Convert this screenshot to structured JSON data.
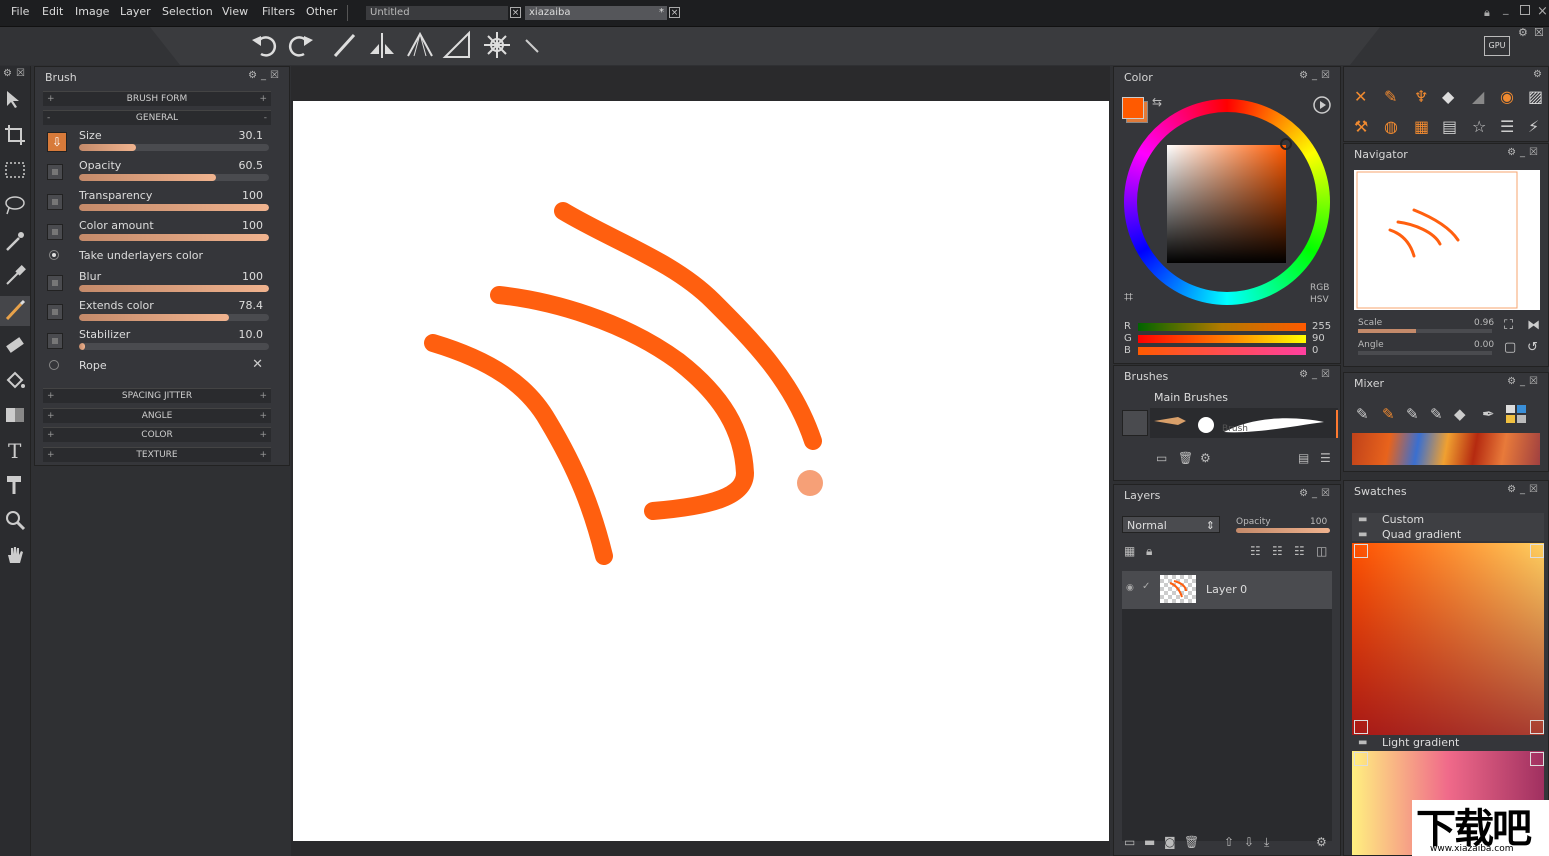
{
  "menu": [
    "File",
    "Edit",
    "Image",
    "Layer",
    "Selection",
    "View",
    "Filters",
    "Other"
  ],
  "tabs": [
    {
      "label": "Untitled"
    },
    {
      "label": "xiazaiba",
      "modified": "*"
    }
  ],
  "window_controls": {
    "close": "×"
  },
  "brush_panel": {
    "title": "Brush",
    "sections": {
      "brush_form": "BRUSH FORM",
      "general": "GENERAL",
      "spacing_jitter": "SPACING JITTER",
      "angle": "ANGLE",
      "color": "COLOR",
      "texture": "TEXTURE"
    },
    "properties": [
      {
        "label": "Size",
        "value": "30.1",
        "fill": 0.3
      },
      {
        "label": "Opacity",
        "value": "60.5",
        "fill": 0.72
      },
      {
        "label": "Transparency",
        "value": "100",
        "fill": 1.0
      },
      {
        "label": "Color amount",
        "value": "100",
        "fill": 1.0
      },
      {
        "label": "Blur",
        "value": "100",
        "fill": 1.0
      },
      {
        "label": "Extends color",
        "value": "78.4",
        "fill": 0.79
      },
      {
        "label": "Stabilizer",
        "value": "10.0",
        "fill": 0.02
      }
    ],
    "take_underlayers": "Take underlayers color",
    "rope": "Rope"
  },
  "color_panel": {
    "title": "Color",
    "mode_rgb": "RGB",
    "mode_hsv": "HSV",
    "r_label": "R",
    "g_label": "G",
    "b_label": "B",
    "r_value": "255",
    "g_value": "90",
    "b_value": "0",
    "current_color": "#ff5a00"
  },
  "brushes_panel": {
    "title": "Brushes",
    "group": "Main Brushes",
    "brush_name": "Brush"
  },
  "layers_panel": {
    "title": "Layers",
    "blend_mode": "Normal",
    "opacity_label": "Opacity",
    "opacity_value": "100",
    "layer_name": "Layer 0"
  },
  "navigator_panel": {
    "title": "Navigator",
    "scale_label": "Scale",
    "scale_value": "0.96",
    "angle_label": "Angle",
    "angle_value": "0.00"
  },
  "mixer_panel": {
    "title": "Mixer"
  },
  "swatches_panel": {
    "title": "Swatches",
    "sets": [
      "Custom",
      "Quad gradient",
      "Light gradient"
    ]
  },
  "watermark": {
    "brand": "下载吧",
    "url": "www.xiazaiba.com"
  },
  "icons": {
    "undo": "undo-icon",
    "redo": "redo-icon",
    "gpu": "GPU"
  }
}
